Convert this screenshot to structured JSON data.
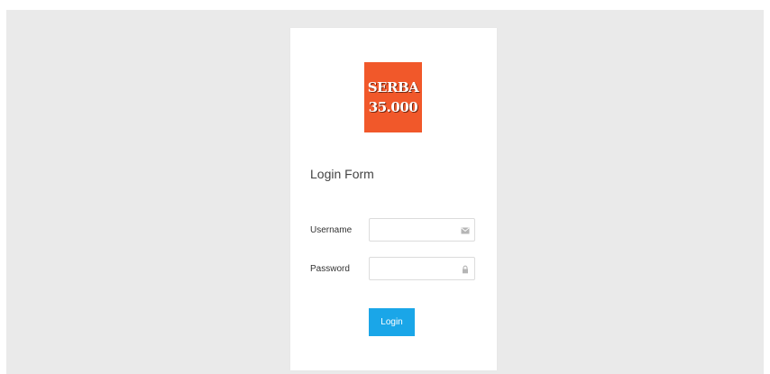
{
  "logo": {
    "line1": "SERBA",
    "line2": "35.000",
    "color": "#f1582a"
  },
  "form": {
    "title": "Login Form",
    "username": {
      "label": "Username",
      "value": "",
      "placeholder": "",
      "icon": "envelope-icon"
    },
    "password": {
      "label": "Password",
      "value": "",
      "placeholder": "",
      "icon": "lock-icon"
    },
    "submit_label": "Login",
    "submit_color": "#1aa6e8"
  },
  "colors": {
    "background": "#eaeaea",
    "card": "#ffffff"
  }
}
